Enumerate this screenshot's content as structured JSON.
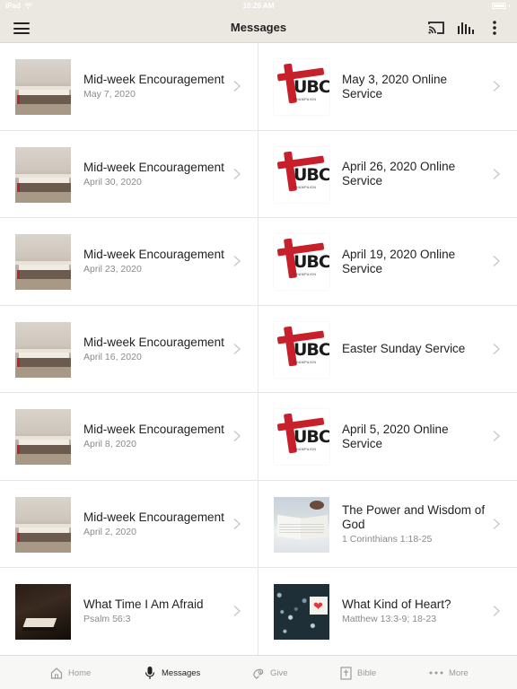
{
  "status_bar": {
    "carrier": "iPad",
    "time": "10:26 AM"
  },
  "header": {
    "title": "Messages"
  },
  "messages_left": [
    {
      "title": "Mid-week Encouragement",
      "subtitle": "May 7, 2020",
      "thumbnail": "bible-on-shelf"
    },
    {
      "title": "Mid-week Encouragement",
      "subtitle": "April 30, 2020",
      "thumbnail": "bible-on-shelf"
    },
    {
      "title": "Mid-week Encouragement",
      "subtitle": "April 23, 2020",
      "thumbnail": "bible-on-shelf"
    },
    {
      "title": "Mid-week Encouragement",
      "subtitle": "April 16, 2020",
      "thumbnail": "bible-on-shelf"
    },
    {
      "title": "Mid-week Encouragement",
      "subtitle": "April 8, 2020",
      "thumbnail": "bible-on-shelf"
    },
    {
      "title": "Mid-week Encouragement",
      "subtitle": "April 2, 2020",
      "thumbnail": "bible-on-shelf"
    },
    {
      "title": "What Time I Am Afraid",
      "subtitle": "Psalm 56:3",
      "thumbnail": "dark-open-book"
    }
  ],
  "messages_right": [
    {
      "title": "May 3, 2020 Online Service",
      "subtitle": "",
      "thumbnail": "ubc-logo"
    },
    {
      "title": "April 26, 2020 Online Service",
      "subtitle": "",
      "thumbnail": "ubc-logo"
    },
    {
      "title": "April 19, 2020 Online Service",
      "subtitle": "",
      "thumbnail": "ubc-logo"
    },
    {
      "title": "Easter Sunday Service",
      "subtitle": "",
      "thumbnail": "ubc-logo"
    },
    {
      "title": "April 5, 2020 Online Service",
      "subtitle": "",
      "thumbnail": "ubc-logo"
    },
    {
      "title": "The Power and Wisdom of God",
      "subtitle": "1 Corinthians 1:18-25",
      "thumbnail": "open-bible-coffee"
    },
    {
      "title": "What Kind of Heart?",
      "subtitle": "Matthew 13:3-9; 18-23",
      "thumbnail": "heart-on-pattern"
    }
  ],
  "logo": {
    "letters": "UBC",
    "sub": "CHAMPAIGN"
  },
  "tabbar": {
    "items": [
      {
        "label": "Home",
        "icon": "home-icon",
        "active": false
      },
      {
        "label": "Messages",
        "icon": "microphone-icon",
        "active": true
      },
      {
        "label": "Give",
        "icon": "give-icon",
        "active": false
      },
      {
        "label": "Bible",
        "icon": "bible-icon",
        "active": false
      },
      {
        "label": "More",
        "icon": "more-dots-icon",
        "active": false
      }
    ]
  },
  "colors": {
    "header_bg": "#ebe8e1",
    "brand_red": "#c8202b",
    "text": "#222222",
    "muted": "#8a8a8a"
  }
}
